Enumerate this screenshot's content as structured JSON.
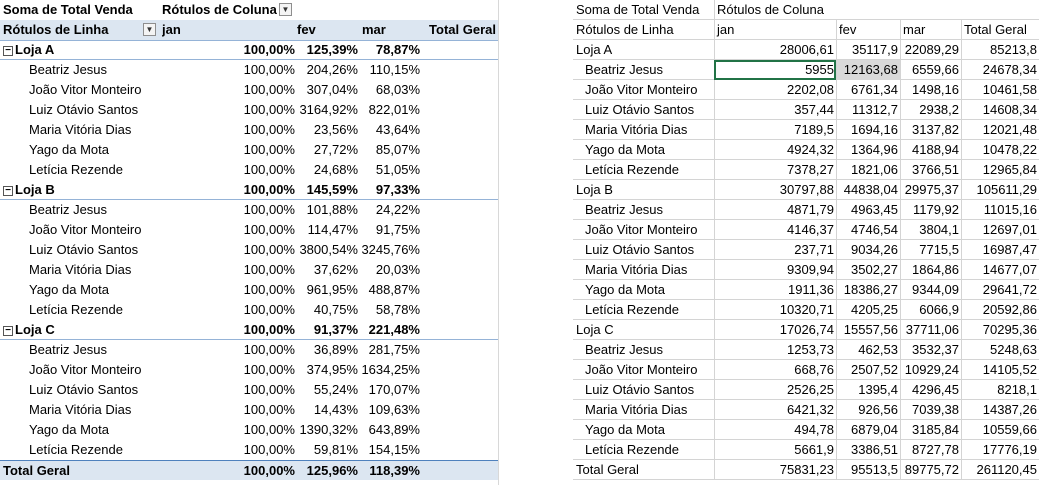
{
  "left": {
    "header1": {
      "value_label": "Soma de Total Venda",
      "col_label": "Rótulos de Coluna"
    },
    "header2": {
      "row_label": "Rótulos de Linha",
      "cols": [
        "jan",
        "fev",
        "mar",
        "Total Geral"
      ]
    },
    "groups": [
      {
        "name": "Loja A",
        "values": [
          "100,00%",
          "125,39%",
          "78,87%"
        ],
        "rows": [
          {
            "name": "Beatriz Jesus",
            "values": [
              "100,00%",
              "204,26%",
              "110,15%"
            ]
          },
          {
            "name": "João Vitor Monteiro",
            "values": [
              "100,00%",
              "307,04%",
              "68,03%"
            ]
          },
          {
            "name": "Luiz Otávio Santos",
            "values": [
              "100,00%",
              "3164,92%",
              "822,01%"
            ]
          },
          {
            "name": "Maria Vitória Dias",
            "values": [
              "100,00%",
              "23,56%",
              "43,64%"
            ]
          },
          {
            "name": "Yago da Mota",
            "values": [
              "100,00%",
              "27,72%",
              "85,07%"
            ]
          },
          {
            "name": "Letícia Rezende",
            "values": [
              "100,00%",
              "24,68%",
              "51,05%"
            ]
          }
        ]
      },
      {
        "name": "Loja B",
        "values": [
          "100,00%",
          "145,59%",
          "97,33%"
        ],
        "rows": [
          {
            "name": "Beatriz Jesus",
            "values": [
              "100,00%",
              "101,88%",
              "24,22%"
            ]
          },
          {
            "name": "João Vitor Monteiro",
            "values": [
              "100,00%",
              "114,47%",
              "91,75%"
            ]
          },
          {
            "name": "Luiz Otávio Santos",
            "values": [
              "100,00%",
              "3800,54%",
              "3245,76%"
            ]
          },
          {
            "name": "Maria Vitória Dias",
            "values": [
              "100,00%",
              "37,62%",
              "20,03%"
            ]
          },
          {
            "name": "Yago da Mota",
            "values": [
              "100,00%",
              "961,95%",
              "488,87%"
            ]
          },
          {
            "name": "Letícia Rezende",
            "values": [
              "100,00%",
              "40,75%",
              "58,78%"
            ]
          }
        ]
      },
      {
        "name": "Loja C",
        "values": [
          "100,00%",
          "91,37%",
          "221,48%"
        ],
        "rows": [
          {
            "name": "Beatriz Jesus",
            "values": [
              "100,00%",
              "36,89%",
              "281,75%"
            ]
          },
          {
            "name": "João Vitor Monteiro",
            "values": [
              "100,00%",
              "374,95%",
              "1634,25%"
            ]
          },
          {
            "name": "Luiz Otávio Santos",
            "values": [
              "100,00%",
              "55,24%",
              "170,07%"
            ]
          },
          {
            "name": "Maria Vitória Dias",
            "values": [
              "100,00%",
              "14,43%",
              "109,63%"
            ]
          },
          {
            "name": "Yago da Mota",
            "values": [
              "100,00%",
              "1390,32%",
              "643,89%"
            ]
          },
          {
            "name": "Letícia Rezende",
            "values": [
              "100,00%",
              "59,81%",
              "154,15%"
            ]
          }
        ]
      }
    ],
    "total": {
      "name": "Total Geral",
      "values": [
        "100,00%",
        "125,96%",
        "118,39%"
      ]
    },
    "expander_symbol": "−"
  },
  "right": {
    "header1": {
      "value_label": "Soma de Total Venda",
      "col_label": "Rótulos de Coluna"
    },
    "header2": {
      "row_label": "Rótulos de Linha",
      "cols": [
        "jan",
        "fev",
        "mar",
        "Total Geral"
      ]
    },
    "groups": [
      {
        "name": "Loja A",
        "values": [
          "28006,61",
          "35117,9",
          "22089,29",
          "85213,8"
        ],
        "rows": [
          {
            "name": "Beatriz Jesus",
            "values": [
              "5955",
              "12163,68",
              "6559,66",
              "24678,34"
            ]
          },
          {
            "name": "João Vitor Monteiro",
            "values": [
              "2202,08",
              "6761,34",
              "1498,16",
              "10461,58"
            ]
          },
          {
            "name": "Luiz Otávio Santos",
            "values": [
              "357,44",
              "11312,7",
              "2938,2",
              "14608,34"
            ]
          },
          {
            "name": "Maria Vitória Dias",
            "values": [
              "7189,5",
              "1694,16",
              "3137,82",
              "12021,48"
            ]
          },
          {
            "name": "Yago da Mota",
            "values": [
              "4924,32",
              "1364,96",
              "4188,94",
              "10478,22"
            ]
          },
          {
            "name": "Letícia Rezende",
            "values": [
              "7378,27",
              "1821,06",
              "3766,51",
              "12965,84"
            ]
          }
        ]
      },
      {
        "name": "Loja B",
        "values": [
          "30797,88",
          "44838,04",
          "29975,37",
          "105611,29"
        ],
        "rows": [
          {
            "name": "Beatriz Jesus",
            "values": [
              "4871,79",
              "4963,45",
              "1179,92",
              "11015,16"
            ]
          },
          {
            "name": "João Vitor Monteiro",
            "values": [
              "4146,37",
              "4746,54",
              "3804,1",
              "12697,01"
            ]
          },
          {
            "name": "Luiz Otávio Santos",
            "values": [
              "237,71",
              "9034,26",
              "7715,5",
              "16987,47"
            ]
          },
          {
            "name": "Maria Vitória Dias",
            "values": [
              "9309,94",
              "3502,27",
              "1864,86",
              "14677,07"
            ]
          },
          {
            "name": "Yago da Mota",
            "values": [
              "1911,36",
              "18386,27",
              "9344,09",
              "29641,72"
            ]
          },
          {
            "name": "Letícia Rezende",
            "values": [
              "10320,71",
              "4205,25",
              "6066,9",
              "20592,86"
            ]
          }
        ]
      },
      {
        "name": "Loja C",
        "values": [
          "17026,74",
          "15557,56",
          "37711,06",
          "70295,36"
        ],
        "rows": [
          {
            "name": "Beatriz Jesus",
            "values": [
              "1253,73",
              "462,53",
              "3532,37",
              "5248,63"
            ]
          },
          {
            "name": "João Vitor Monteiro",
            "values": [
              "668,76",
              "2507,52",
              "10929,24",
              "14105,52"
            ]
          },
          {
            "name": "Luiz Otávio Santos",
            "values": [
              "2526,25",
              "1395,4",
              "4296,45",
              "8218,1"
            ]
          },
          {
            "name": "Maria Vitória Dias",
            "values": [
              "6421,32",
              "926,56",
              "7039,38",
              "14387,26"
            ]
          },
          {
            "name": "Yago da Mota",
            "values": [
              "494,78",
              "6879,04",
              "3185,84",
              "10559,66"
            ]
          },
          {
            "name": "Letícia Rezende",
            "values": [
              "5661,9",
              "3386,51",
              "8727,78",
              "17776,19"
            ]
          }
        ]
      }
    ],
    "total": {
      "name": "Total Geral",
      "values": [
        "75831,23",
        "95513,5",
        "89775,72",
        "261120,45"
      ]
    },
    "selected_cell": "5955",
    "shaded_cell": "12163,68"
  }
}
